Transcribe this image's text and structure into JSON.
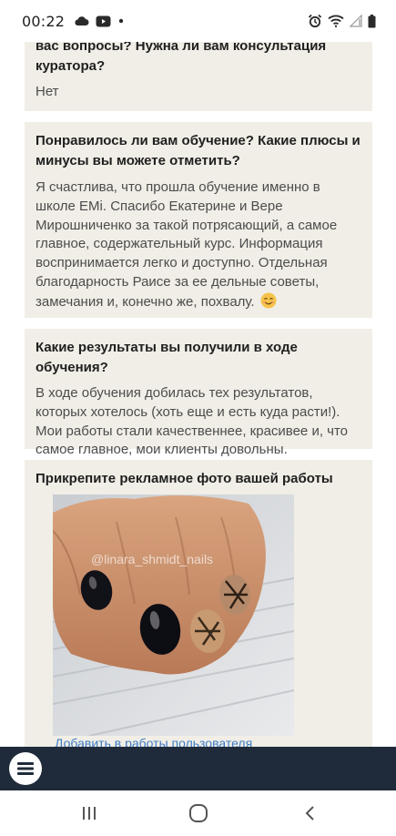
{
  "status_bar": {
    "time": "00:22",
    "left_icons": [
      "cloud-icon",
      "youtube-icon",
      "dot-icon"
    ],
    "right_icons": [
      "alarm-icon",
      "wifi-icon",
      "signal-icon",
      "battery-icon"
    ]
  },
  "cards": [
    {
      "question": "вас вопросы? Нужна ли вам консультация куратора?",
      "answer": "Нет"
    },
    {
      "question": "Понравилось ли вам обучение? Какие плюсы и минусы вы можете отметить?",
      "answer": "Я счастлива, что прошла обучение именно в школе EMi. Спасибо Екатерине и Вере Мирошниченко за такой потрясающий, а самое главное, содержательный курс. Информация воспринимается легко и доступно. Отдельная благодарность Раисе за ее дельные советы, замечания и, конечно же, похвалу.",
      "emoji": "smiling-face-emoji"
    },
    {
      "question": "Какие результаты вы получили в ходе обучения?",
      "answer": "В ходе обучения добилась тех результатов, которых хотелось (хоть еще и есть куда расти!). Мои работы стали качественнее, красивее и, что самое главное, мои клиенты довольны."
    },
    {
      "question": "Прикрепите рекламное фото вашей работы",
      "photo_watermark": "@linara_shmidt_nails",
      "link_text": "Добавить в работы пользователя"
    }
  ],
  "bottom_bar": {
    "menu_icon": "hamburger-menu-icon"
  },
  "nav_bar": {
    "buttons": [
      "recent-apps-icon",
      "home-icon",
      "back-icon"
    ]
  },
  "colors": {
    "card_bg": "#f0eee6",
    "bottom_bar": "#1f2b3a",
    "link": "#3f7cc4"
  }
}
